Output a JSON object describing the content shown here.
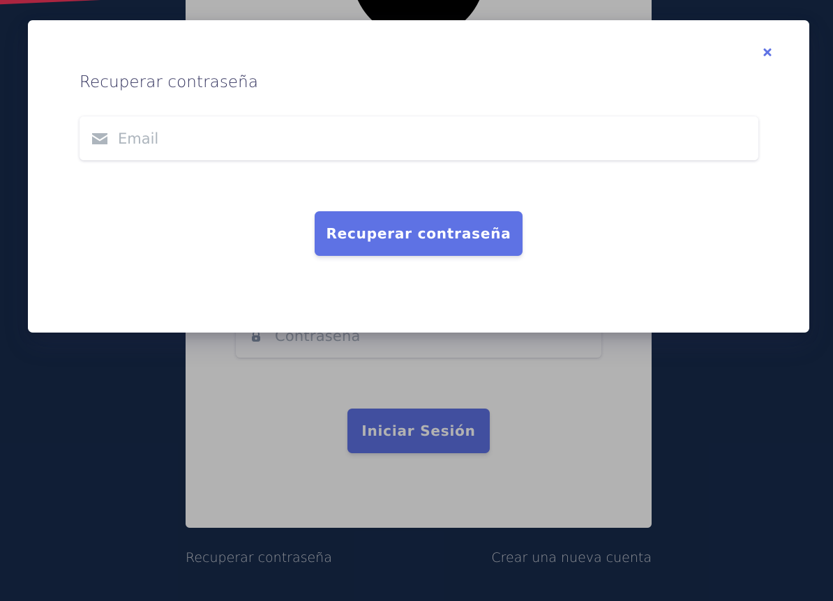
{
  "background": {
    "login_form": {
      "password_placeholder": "Contraseña",
      "submit_label": "Iniciar Sesión"
    },
    "links": {
      "recover": "Recuperar contraseña",
      "create_account": "Crear una nueva cuenta"
    }
  },
  "modal": {
    "title": "Recuperar contraseña",
    "close_icon": "close-icon",
    "email": {
      "icon": "envelope-icon",
      "placeholder": "Email",
      "value": ""
    },
    "submit_label": "Recuperar contraseña"
  },
  "colors": {
    "accent": "#5e72e4",
    "page_background": "#172b4d",
    "brand_red": "#f5365c"
  }
}
